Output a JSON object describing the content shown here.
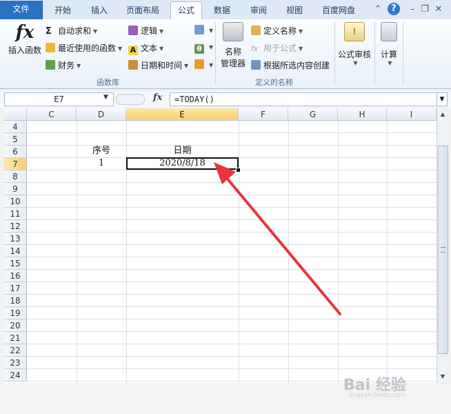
{
  "tabs": [
    "文件",
    "开始",
    "插入",
    "页面布局",
    "公式",
    "数据",
    "审阅",
    "视图",
    "百度网盘"
  ],
  "active_tab": "公式",
  "window_controls": {
    "help": "?"
  },
  "ribbon": {
    "insert_function": "插入函数",
    "library": {
      "autosum": "自动求和",
      "recent": "最近使用的函数",
      "financial": "财务",
      "logical": "逻辑",
      "text": "文本",
      "datetime": "日期和时间",
      "label": "函数库"
    },
    "names": {
      "name_manager_1": "名称",
      "name_manager_2": "管理器",
      "define_name": "定义名称",
      "use_in_formula": "用于公式",
      "create_from_selection": "根据所选内容创建",
      "label": "定义的名称"
    },
    "audit": "公式审核",
    "calc": "计算"
  },
  "formula_bar": {
    "name_box": "E7",
    "fx": "fx",
    "formula": "=TODAY()"
  },
  "columns": [
    "C",
    "D",
    "E",
    "F",
    "G",
    "H",
    "I"
  ],
  "selected_column": "E",
  "rows": [
    "4",
    "5",
    "6",
    "7",
    "8",
    "9",
    "10",
    "11",
    "12",
    "13",
    "14",
    "15",
    "16",
    "17",
    "18",
    "19",
    "20",
    "21",
    "22",
    "23",
    "24"
  ],
  "selected_row": "7",
  "cells": {
    "D6": "序号",
    "E6": "日期",
    "D7": "1",
    "E7": "2020/8/18"
  },
  "watermark": {
    "main": "Bai 经验",
    "sub": "jingyan.baidu.com"
  }
}
